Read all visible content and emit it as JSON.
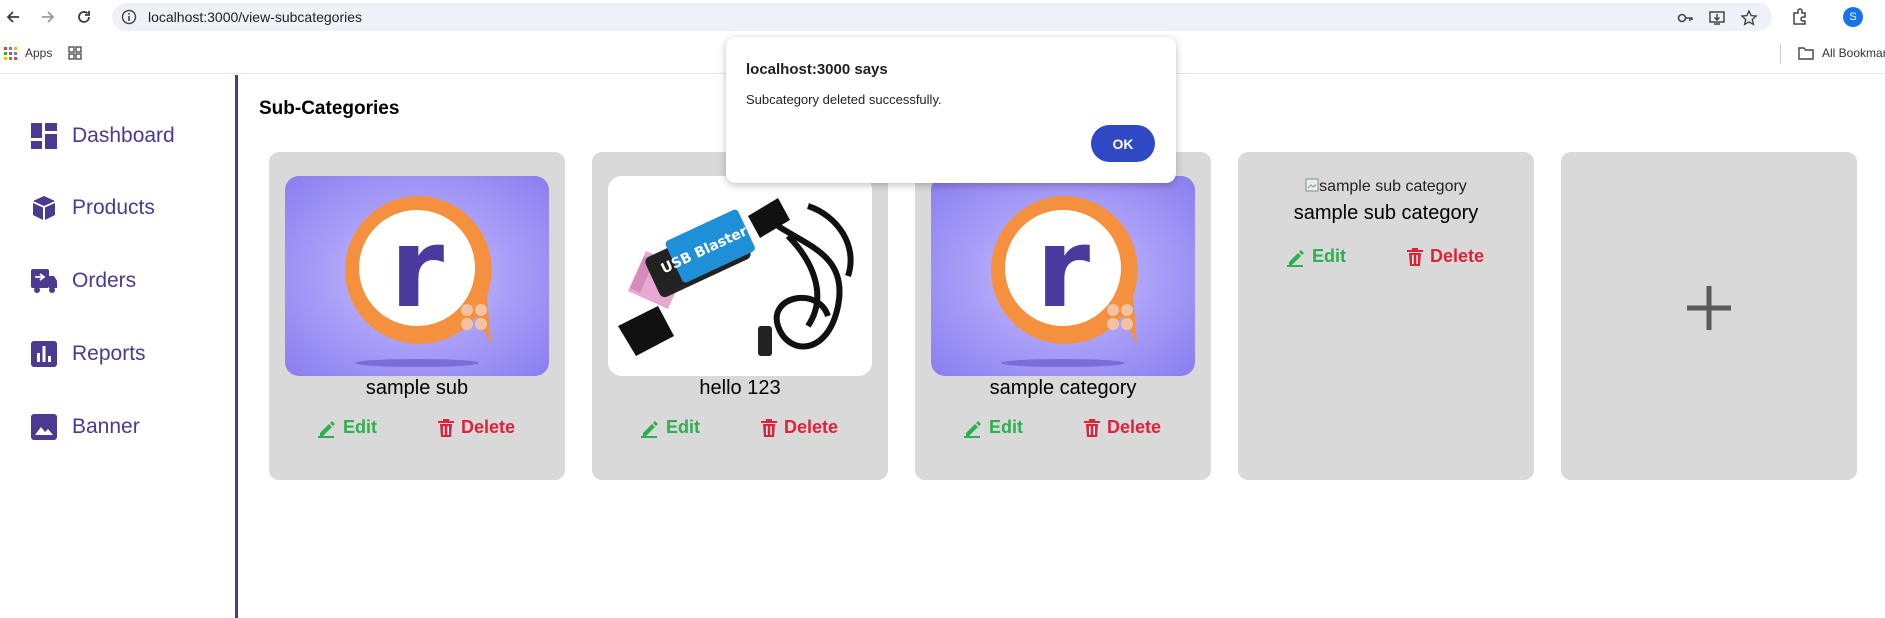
{
  "browser": {
    "url": "localhost:3000/view-subcategories",
    "bookmarks_apps": "Apps",
    "all_bookmarks": "All Bookmar",
    "profile_initial": "S"
  },
  "sidebar": {
    "items": [
      {
        "label": "Dashboard",
        "icon": "dashboard-icon"
      },
      {
        "label": "Products",
        "icon": "box-icon"
      },
      {
        "label": "Orders",
        "icon": "orders-icon"
      },
      {
        "label": "Reports",
        "icon": "bar-chart-icon"
      },
      {
        "label": "Banner",
        "icon": "image-icon"
      }
    ],
    "accent": "#4b3a8f"
  },
  "main": {
    "title": "Sub-Categories",
    "cards": [
      {
        "name": "sample sub",
        "image": "orange-r-logo",
        "edit": "Edit",
        "delete": "Delete"
      },
      {
        "name": "hello 123",
        "image": "usb-blaster-photo",
        "edit": "Edit",
        "delete": "Delete"
      },
      {
        "name": "sample category",
        "image": "orange-r-logo",
        "edit": "Edit",
        "delete": "Delete"
      },
      {
        "name": "sample sub category",
        "image_alt": "sample sub category",
        "edit": "Edit",
        "delete": "Delete"
      }
    ],
    "add_icon": "plus-icon"
  },
  "dialog": {
    "title": "localhost:3000 says",
    "message": "Subcategory deleted successfully.",
    "ok": "OK"
  },
  "colors": {
    "edit": "#2eaf4f",
    "delete": "#e0213b",
    "card_bg": "#d9d9d9",
    "ok_button": "#2f49c5"
  }
}
